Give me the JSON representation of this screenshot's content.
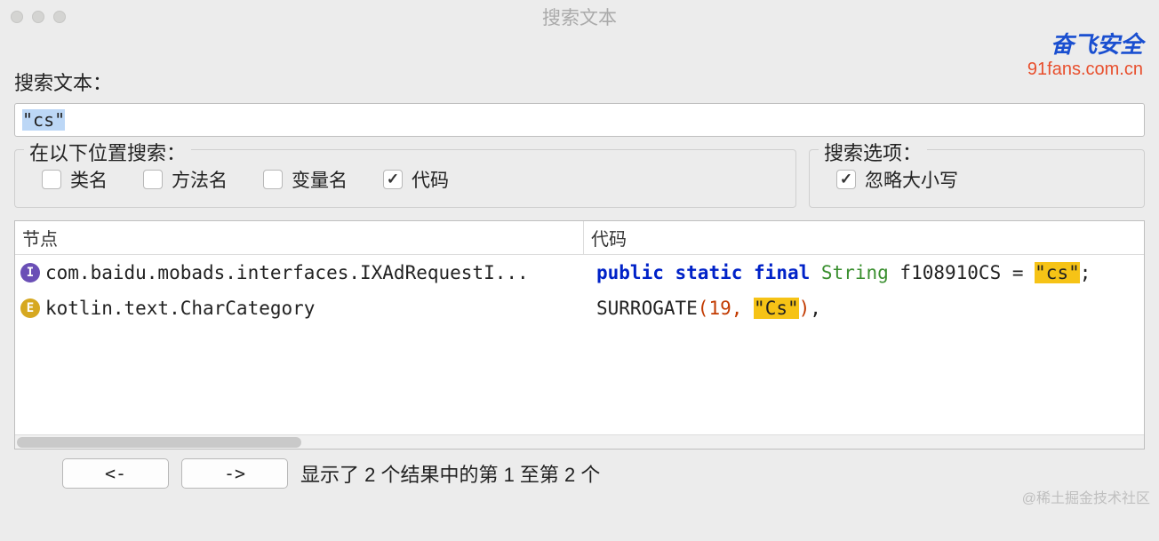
{
  "window": {
    "title": "搜索文本"
  },
  "brand": {
    "top": "奋飞安全",
    "bottom": "91fans.com.cn"
  },
  "search": {
    "label": "搜索文本：",
    "value": "\"cs\""
  },
  "scope": {
    "legend": "在以下位置搜索：",
    "options": [
      {
        "label": "类名",
        "checked": false
      },
      {
        "label": "方法名",
        "checked": false
      },
      {
        "label": "变量名",
        "checked": false
      },
      {
        "label": "代码",
        "checked": true
      }
    ]
  },
  "options": {
    "legend": "搜索选项：",
    "items": [
      {
        "label": "忽略大小写",
        "checked": true
      }
    ]
  },
  "results": {
    "columns": {
      "node": "节点",
      "code": "代码"
    },
    "rows": [
      {
        "icon": "I",
        "icon_color": "purple",
        "node": "com.baidu.mobads.interfaces.IXAdRequestI...",
        "code": {
          "tokens": [
            {
              "t": "public",
              "c": "kw-blue"
            },
            {
              "t": " "
            },
            {
              "t": "static",
              "c": "kw-blue"
            },
            {
              "t": " "
            },
            {
              "t": "final",
              "c": "kw-blue"
            },
            {
              "t": " "
            },
            {
              "t": "String",
              "c": "kw-green"
            },
            {
              "t": " "
            },
            {
              "t": "f108910CS"
            },
            {
              "t": " = "
            },
            {
              "t": "\"cs\"",
              "c": "hl"
            },
            {
              "t": ";"
            }
          ]
        }
      },
      {
        "icon": "E",
        "icon_color": "orange",
        "node": "kotlin.text.CharCategory",
        "code": {
          "tokens": [
            {
              "t": "SURROGATE"
            },
            {
              "t": "(",
              "c": "kw-red"
            },
            {
              "t": "19",
              "c": "kw-red"
            },
            {
              "t": ", ",
              "c": "kw-red"
            },
            {
              "t": "\"Cs\"",
              "c": "hl"
            },
            {
              "t": ")",
              "c": "kw-red"
            },
            {
              "t": ","
            }
          ]
        }
      }
    ]
  },
  "nav": {
    "prev": "<-",
    "next": "->"
  },
  "status": "显示了 2 个结果中的第 1 至第 2 个",
  "watermark": "@稀土掘金技术社区"
}
